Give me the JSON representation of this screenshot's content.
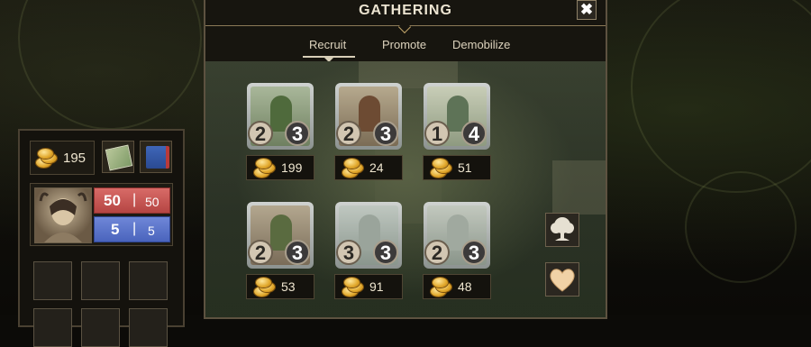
{
  "colors": {
    "panel_border": "#5d5240",
    "hp": "#c4514e",
    "mp": "#5a73c9",
    "gold": "#e0a629"
  },
  "player": {
    "gold": "195",
    "hp_current": "50",
    "hp_max": "50",
    "mp_current": "5",
    "mp_max": "5",
    "inventory_items": [
      "map-icon",
      "spellbook-icon"
    ]
  },
  "modal": {
    "title": "GATHERING",
    "close_label": "✖",
    "tabs": [
      {
        "label": "Recruit",
        "active": true
      },
      {
        "label": "Promote",
        "active": false
      },
      {
        "label": "Demobilize",
        "active": false
      }
    ],
    "units": [
      {
        "attack": "2",
        "defense": "3",
        "cost": "199",
        "art": "dryad-warrior-icon"
      },
      {
        "attack": "2",
        "defense": "3",
        "cost": "24",
        "art": "spearman-icon"
      },
      {
        "attack": "1",
        "defense": "4",
        "cost": "51",
        "art": "bard-icon"
      },
      {
        "attack": "2",
        "defense": "3",
        "cost": "53",
        "art": "druid-icon"
      },
      {
        "attack": "3",
        "defense": "3",
        "cost": "91",
        "art": "pegasus-knight-icon"
      },
      {
        "attack": "2",
        "defense": "3",
        "cost": "48",
        "art": "pegasus-knight-icon"
      }
    ],
    "side_buttons": [
      "tree-icon",
      "heart-icon"
    ]
  }
}
